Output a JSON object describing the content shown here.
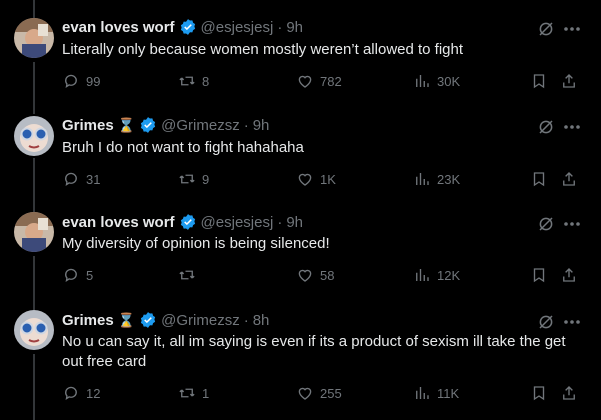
{
  "tweets": [
    {
      "name": "evan loves worf",
      "handle": "@esjesjesj",
      "time": "9h",
      "hourglass": "",
      "text": "Literally only because women mostly weren’t allowed to fight",
      "replies": "99",
      "reposts": "8",
      "likes": "782",
      "views": "30K"
    },
    {
      "name": "Grimes",
      "handle": "@Grimezsz",
      "time": "9h",
      "hourglass": "⌛",
      "text": "Bruh I do not want to fight hahahaha",
      "replies": "31",
      "reposts": "9",
      "likes": "1K",
      "views": "23K"
    },
    {
      "name": "evan loves worf",
      "handle": "@esjesjesj",
      "time": "9h",
      "hourglass": "",
      "text": "My diversity of opinion is being silenced!",
      "replies": "5",
      "reposts": "",
      "likes": "58",
      "views": "12K"
    },
    {
      "name": "Grimes",
      "handle": "@Grimezsz",
      "time": "8h",
      "hourglass": "⌛",
      "text": "No u can say it, all im saying is even if its a product of sexism ill take the get out free card",
      "replies": "12",
      "reposts": "1",
      "likes": "255",
      "views": "11K"
    }
  ],
  "icons": {
    "reply": "reply-icon",
    "repost": "repost-icon",
    "like": "heart-icon",
    "views": "views-icon",
    "bookmark": "bookmark-icon",
    "share": "share-icon",
    "grok": "grok-icon",
    "more": "more-icon",
    "verified": "verified-badge-icon"
  },
  "colors": {
    "background": "#000000",
    "text": "#e7e9ea",
    "muted": "#71767b",
    "verified": "#1d9bf0",
    "thread_line": "#333639"
  }
}
